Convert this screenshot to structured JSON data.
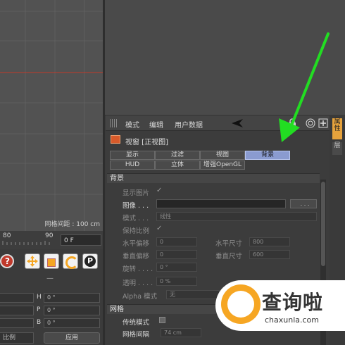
{
  "viewport": {
    "grid_spacing_label": "网格间距 : 100 cm"
  },
  "timeline": {
    "ticks": [
      "80",
      "90"
    ],
    "frame_value": "0 F"
  },
  "coords": {
    "section_marker": "—",
    "rows": [
      {
        "axis": "H",
        "value": "0 °"
      },
      {
        "axis": "P",
        "value": "0 °"
      },
      {
        "axis": "B",
        "value": "0 °"
      }
    ],
    "scale_mode": "比例",
    "apply_label": "应用"
  },
  "menubar": {
    "items": [
      "模式",
      "编辑",
      "用户数据"
    ]
  },
  "object": {
    "title": "视窗 [正视图]"
  },
  "tabs": {
    "row1": [
      "显示",
      "过滤",
      "视图",
      "背景"
    ],
    "row2": [
      "HUD",
      "立体",
      "增强OpenGL"
    ],
    "active": "背景"
  },
  "background_section": {
    "header": "背景",
    "show_image_label": "显示图片",
    "image_label": "图像 . . .",
    "image_browse": ". . .",
    "mode_label": "模式 . . .",
    "mode_value": "线性",
    "keep_ratio_label": "保持比例",
    "h_offset_label": "水平偏移",
    "h_offset_value": "0",
    "h_size_label": "水平尺寸",
    "h_size_value": "800",
    "v_offset_label": "垂直偏移",
    "v_offset_value": "0",
    "v_size_label": "垂直尺寸",
    "v_size_value": "600",
    "rotate_label": "旋转 . . . .",
    "rotate_value": "0 °",
    "transparency_label": "透明 . . . .",
    "transparency_value": "0 %",
    "alpha_label": "Alpha 模式",
    "alpha_value": "无"
  },
  "grid_section": {
    "header": "网格",
    "legacy_label": "传统模式",
    "spacing_label": "网格间隔",
    "spacing_value": "74 cm"
  },
  "side_tabs": [
    "属性",
    "层"
  ],
  "watermark": {
    "text": "查询啦",
    "url": "chaxunla.com"
  },
  "colors": {
    "accent_tab": "#8a9bd0",
    "arrow": "#22dd22",
    "axis_red": "#c0392b"
  },
  "icons": [
    "move-icon",
    "scale-icon",
    "rotate-icon",
    "p-icon",
    "help-icon",
    "cursor-icon",
    "target-icon",
    "lock-icon",
    "new-icon"
  ]
}
